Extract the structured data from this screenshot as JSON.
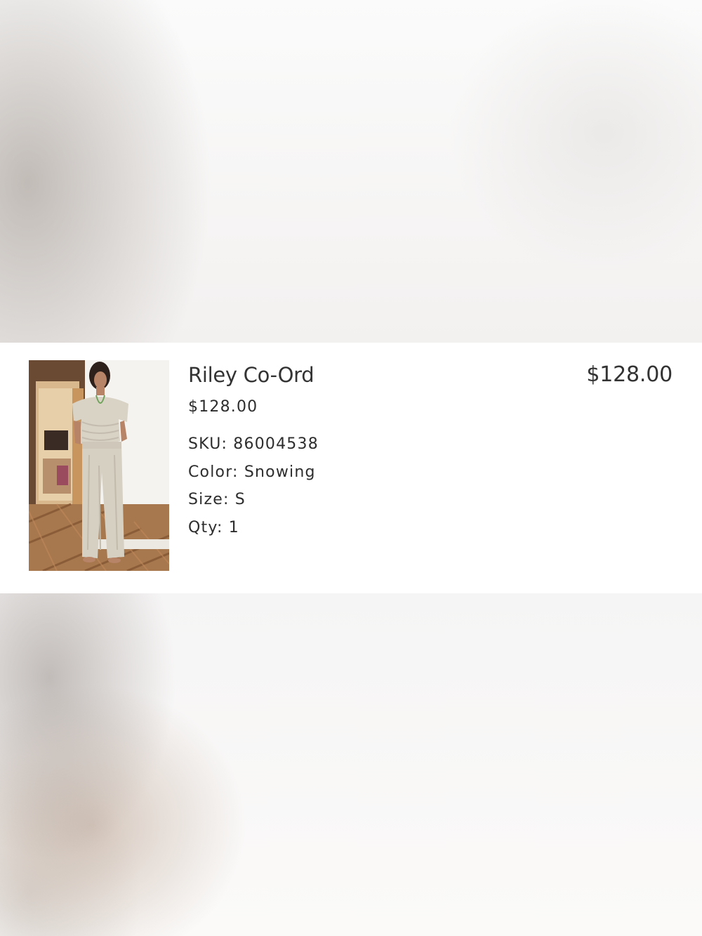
{
  "item": {
    "image_alt": "Riley Co-Ord product photo",
    "name": "Riley Co-Ord",
    "unit_price": "$128.00",
    "sku": "SKU: 86004538",
    "color": "Color: Snowing",
    "size": "Size: S",
    "qty": "Qty: 1",
    "line_total": "$128.00"
  },
  "colors": {
    "row_background": "#ffffff",
    "text": "#2b2b2b",
    "garment": "#d9d3c6",
    "floor": "#9c6a42"
  },
  "icons": {
    "product_image": "photo-of-model"
  }
}
